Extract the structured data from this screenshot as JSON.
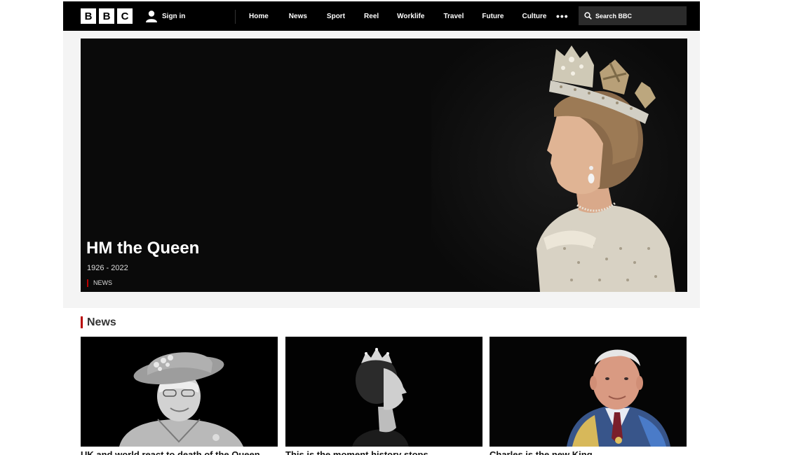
{
  "header": {
    "logo_letters": [
      "B",
      "B",
      "C"
    ],
    "signin_label": "Sign in",
    "nav_items": [
      "Home",
      "News",
      "Sport",
      "Reel",
      "Worklife",
      "Travel",
      "Future",
      "Culture"
    ],
    "more_label": "•••",
    "search_placeholder": "Search BBC"
  },
  "hero": {
    "title": "HM the Queen",
    "subtitle": "1926 - 2022",
    "tag": "NEWS"
  },
  "news": {
    "heading": "News",
    "cards": [
      {
        "headline": "UK and world react to death of the Queen"
      },
      {
        "headline": "This is the moment history stops"
      },
      {
        "headline": "Charles is the new King"
      }
    ]
  },
  "colors": {
    "accent": "#b80000",
    "topbar": "#000000",
    "hero_background": "#0a0a0a"
  }
}
